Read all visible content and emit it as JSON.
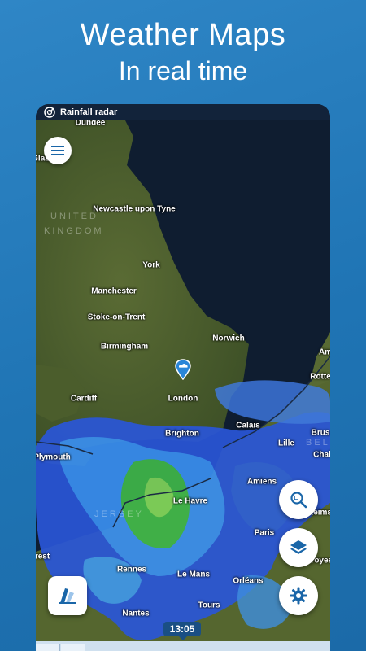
{
  "promo": {
    "title": "Weather Maps",
    "subtitle": "In real time"
  },
  "app": {
    "screen_title": "Rainfall radar"
  },
  "map": {
    "regions": [
      {
        "id": "united",
        "label": "UNITED"
      },
      {
        "id": "kingdom",
        "label": "KINGDOM"
      },
      {
        "id": "jersey",
        "label": "JERSEY"
      },
      {
        "id": "belgium",
        "label": "BEL"
      }
    ],
    "cities": [
      {
        "name": "Dundee"
      },
      {
        "name": "Glas"
      },
      {
        "name": "Newcastle upon Tyne"
      },
      {
        "name": "York"
      },
      {
        "name": "Manchester"
      },
      {
        "name": "Stoke-on-Trent"
      },
      {
        "name": "Norwich"
      },
      {
        "name": "Birmingham"
      },
      {
        "name": "Am"
      },
      {
        "name": "Rotte"
      },
      {
        "name": "Cardiff"
      },
      {
        "name": "London"
      },
      {
        "name": "Calais"
      },
      {
        "name": "Brus"
      },
      {
        "name": "Brighton"
      },
      {
        "name": "Lille"
      },
      {
        "name": "Plymouth"
      },
      {
        "name": "Chai"
      },
      {
        "name": "Amiens"
      },
      {
        "name": "Le Havre"
      },
      {
        "name": "Reims"
      },
      {
        "name": "Paris"
      },
      {
        "name": "rest"
      },
      {
        "name": "Troyes"
      },
      {
        "name": "Rennes"
      },
      {
        "name": "Le Mans"
      },
      {
        "name": "Orléans"
      },
      {
        "name": "Nantes"
      },
      {
        "name": "Tours"
      }
    ]
  },
  "controls": {
    "time": "13:05",
    "menu_icon": "hamburger-menu-icon",
    "zoom_icon": "magnifier-zoom-icon",
    "layers_icon": "layers-icon",
    "settings_icon": "gear-icon",
    "legend_icon": "legend-icon"
  },
  "colors": {
    "background": "#2f86c6",
    "accent": "#1a66a8",
    "time_badge": "#1a4f84"
  }
}
